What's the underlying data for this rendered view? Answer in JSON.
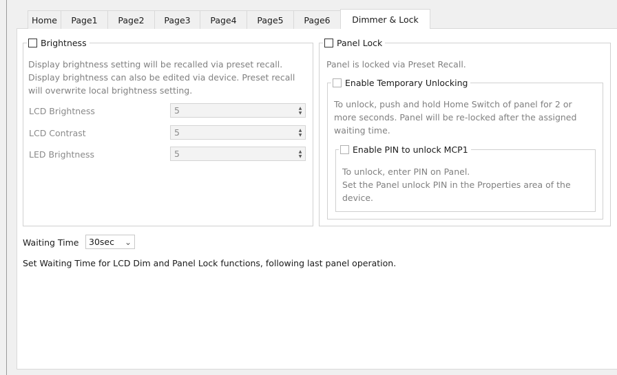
{
  "tabs": [
    {
      "label": "Home"
    },
    {
      "label": "Page1"
    },
    {
      "label": "Page2"
    },
    {
      "label": "Page3"
    },
    {
      "label": "Page4"
    },
    {
      "label": "Page5"
    },
    {
      "label": "Page6"
    },
    {
      "label": "Dimmer & Lock",
      "active": true
    }
  ],
  "brightness": {
    "title": "Brightness",
    "desc": [
      "Display brightness setting will be recalled via preset recall.",
      "Display brightness can also be edited via device. Preset recall",
      "will overwrite local brightness setting."
    ],
    "fields": [
      {
        "label": "LCD Brightness",
        "value": "5"
      },
      {
        "label": "LCD Contrast",
        "value": "5"
      },
      {
        "label": "LED Brightness",
        "value": "5"
      }
    ]
  },
  "panel_lock": {
    "title": "Panel Lock",
    "desc": "Panel is locked via Preset Recall.",
    "temp_unlock": {
      "title": "Enable Temporary Unlocking",
      "desc": [
        "To unlock, push and hold Home Switch of panel for 2 or",
        "more seconds. Panel will be re-locked after the assigned",
        "waiting time."
      ],
      "pin": {
        "title": "Enable PIN to unlock MCP1",
        "desc": [
          "To unlock, enter PIN on Panel.",
          "Set the Panel unlock PIN in the Properties area of the",
          "device."
        ]
      }
    }
  },
  "waiting": {
    "label": "Waiting Time",
    "value": "30sec",
    "desc": "Set Waiting Time for LCD Dim and Panel Lock functions, following last panel operation."
  },
  "icons": {
    "spin_up": "▲",
    "spin_down": "▼",
    "dropdown": "⌄"
  }
}
